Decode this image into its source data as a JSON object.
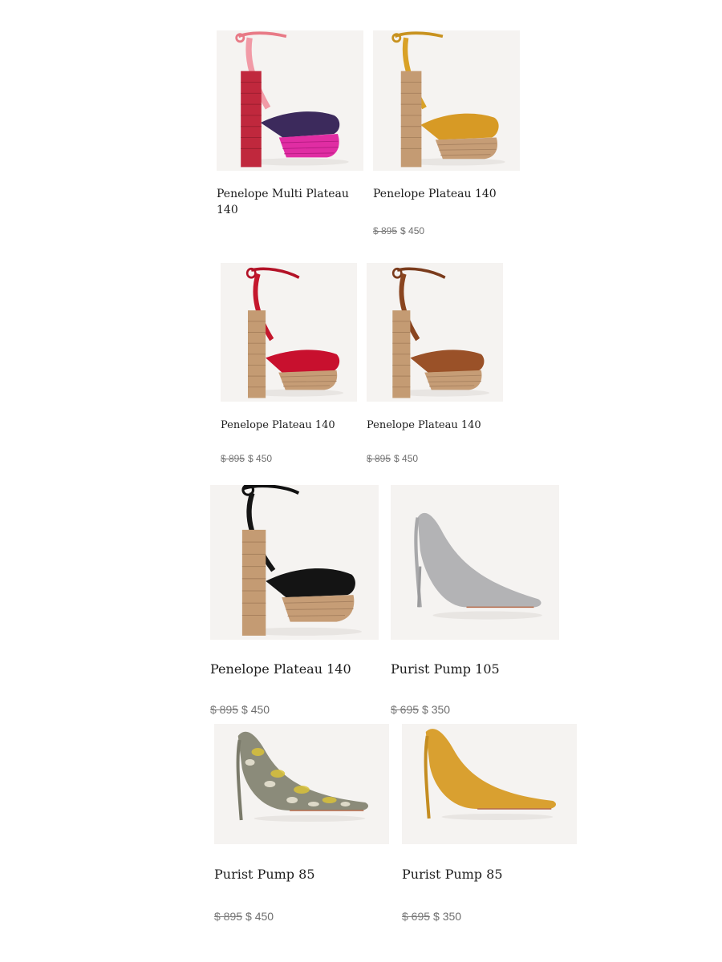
{
  "products": [
    {
      "name": "Penelope Multi Plateau 140",
      "price_original": "",
      "price_sale": "",
      "style": "platform-multi"
    },
    {
      "name": "Penelope Plateau 140",
      "price_original": "$ 895",
      "price_sale": "$ 450",
      "style": "platform-mustard"
    },
    {
      "name": "Penelope Plateau 140",
      "price_original": "$ 895",
      "price_sale": "$ 450",
      "style": "platform-red"
    },
    {
      "name": "Penelope Plateau 140",
      "price_original": "$ 895",
      "price_sale": "$ 450",
      "style": "platform-brown"
    },
    {
      "name": "Penelope Plateau 140",
      "price_original": "$ 895",
      "price_sale": "$ 450",
      "style": "platform-black"
    },
    {
      "name": "Purist Pump 105",
      "price_original": "$ 695",
      "price_sale": "$ 350",
      "style": "pump-grey"
    },
    {
      "name": "Purist Pump 85",
      "price_original": "$ 895",
      "price_sale": "$ 450",
      "style": "pump-python"
    },
    {
      "name": "Purist Pump 85",
      "price_original": "$ 695",
      "price_sale": "$ 350",
      "style": "pump-mustard"
    }
  ],
  "colors": {
    "image_bg": "#f5f3f1",
    "text": "#1c1c1c",
    "price_text": "#6d6d6d"
  }
}
